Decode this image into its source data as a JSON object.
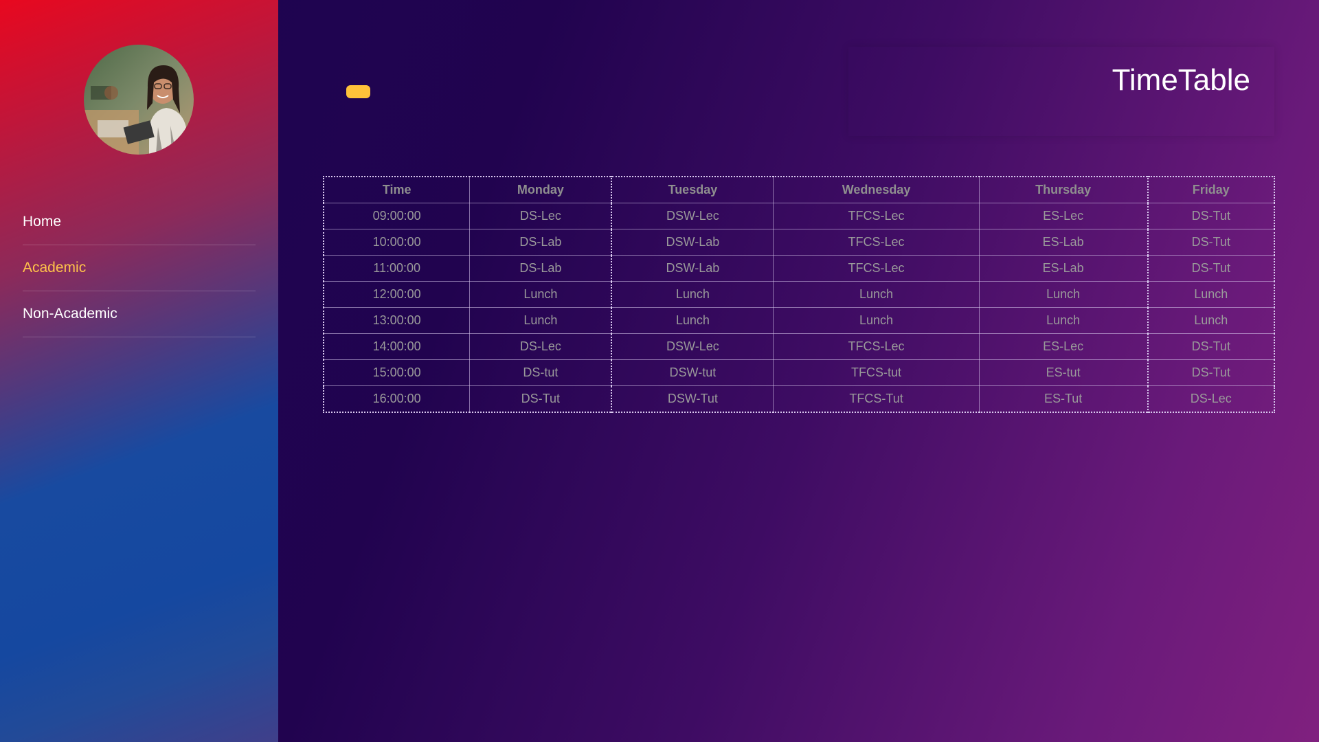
{
  "sidebar": {
    "avatar_icon": "profile-photo",
    "nav": [
      {
        "label": "Home",
        "active": false
      },
      {
        "label": "Academic",
        "active": true
      },
      {
        "label": "Non-Academic",
        "active": false
      }
    ]
  },
  "header": {
    "title": "TimeTable"
  },
  "colors": {
    "accent": "#ffc23a",
    "active_nav": "#ffc34a",
    "background_start": "#1c0552",
    "background_end": "#80207f"
  },
  "timetable": {
    "headers": [
      "Time",
      "Monday",
      "Tuesday",
      "Wednesday",
      "Thursday",
      "Friday"
    ],
    "rows": [
      [
        "09:00:00",
        "DS-Lec",
        "DSW-Lec",
        "TFCS-Lec",
        "ES-Lec",
        "DS-Tut"
      ],
      [
        "10:00:00",
        "DS-Lab",
        "DSW-Lab",
        "TFCS-Lec",
        "ES-Lab",
        "DS-Tut"
      ],
      [
        "11:00:00",
        "DS-Lab",
        "DSW-Lab",
        "TFCS-Lec",
        "ES-Lab",
        "DS-Tut"
      ],
      [
        "12:00:00",
        "Lunch",
        "Lunch",
        "Lunch",
        "Lunch",
        "Lunch"
      ],
      [
        "13:00:00",
        "Lunch",
        "Lunch",
        "Lunch",
        "Lunch",
        "Lunch"
      ],
      [
        "14:00:00",
        "DS-Lec",
        "DSW-Lec",
        "TFCS-Lec",
        "ES-Lec",
        "DS-Tut"
      ],
      [
        "15:00:00",
        "DS-tut",
        "DSW-tut",
        "TFCS-tut",
        "ES-tut",
        "DS-Tut"
      ],
      [
        "16:00:00",
        "DS-Tut",
        "DSW-Tut",
        "TFCS-Tut",
        "ES-Tut",
        "DS-Lec"
      ]
    ]
  }
}
